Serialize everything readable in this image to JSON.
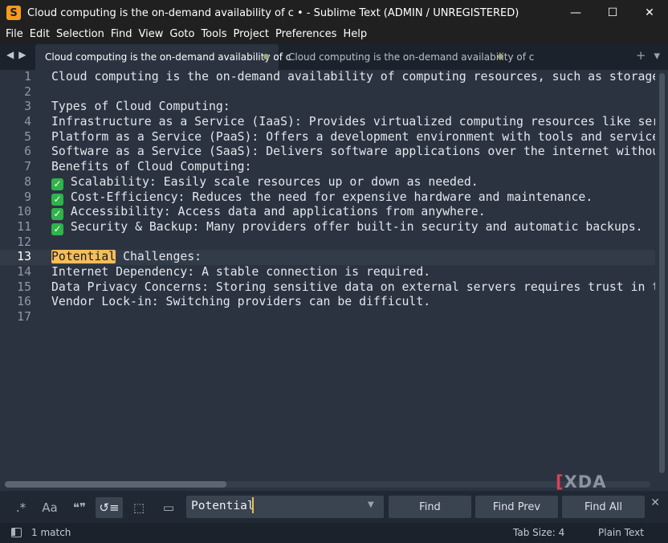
{
  "window": {
    "title": "Cloud computing is the on-demand availability of c • - Sublime Text (ADMIN / UNREGISTERED)",
    "app_icon": "S",
    "controls": {
      "minimize": "—",
      "maximize": "☐",
      "close": "✕"
    }
  },
  "menu": [
    "File",
    "Edit",
    "Selection",
    "Find",
    "View",
    "Goto",
    "Tools",
    "Project",
    "Preferences",
    "Help"
  ],
  "tabs": [
    {
      "label": "Cloud computing is the on-demand availability of c",
      "active": true,
      "modified": true
    },
    {
      "label": "Cloud computing is the on-demand availability of c",
      "active": false,
      "modified": true
    }
  ],
  "tabbar": {
    "nav_left": "◀",
    "nav_right": "▶",
    "new_tab": "+",
    "overflow": "▾"
  },
  "editor": {
    "current_line": 13,
    "lines": [
      {
        "n": "1",
        "text": "Cloud computing is the on-demand availability of computing resources, such as storage, processing power"
      },
      {
        "n": "2",
        "text": ""
      },
      {
        "n": "3",
        "text": "Types of Cloud Computing:"
      },
      {
        "n": "4",
        "text": "Infrastructure as a Service (IaaS): Provides virtualized computing resources like servers and storage."
      },
      {
        "n": "5",
        "text": "Platform as a Service (PaaS): Offers a development environment with tools and services for developers."
      },
      {
        "n": "6",
        "text": "Software as a Service (SaaS): Delivers software applications over the internet without installation."
      },
      {
        "n": "7",
        "text": "Benefits of Cloud Computing:"
      },
      {
        "n": "8",
        "check": true,
        "text": " Scalability: Easily scale resources up or down as needed."
      },
      {
        "n": "9",
        "check": true,
        "text": " Cost-Efficiency: Reduces the need for expensive hardware and maintenance."
      },
      {
        "n": "10",
        "check": true,
        "text": " Accessibility: Access data and applications from anywhere."
      },
      {
        "n": "11",
        "check": true,
        "text": " Security & Backup: Many providers offer built-in security and automatic backups."
      },
      {
        "n": "12",
        "text": ""
      },
      {
        "n": "13",
        "match": "Potential",
        "text": " Challenges:"
      },
      {
        "n": "14",
        "text": "Internet Dependency: A stable connection is required."
      },
      {
        "n": "15",
        "text": "Data Privacy Concerns: Storing sensitive data on external servers requires trust in the provider."
      },
      {
        "n": "16",
        "text": "Vendor Lock-in: Switching providers can be difficult."
      },
      {
        "n": "17",
        "text": ""
      }
    ]
  },
  "watermark": {
    "bracket_left": "[",
    "bracket_right": "]",
    "text": "XDA"
  },
  "find": {
    "options": [
      {
        "name": "regex-toggle",
        "glyph": ".*",
        "on": false
      },
      {
        "name": "case-toggle",
        "glyph": "Aa",
        "on": false
      },
      {
        "name": "whole-word-toggle",
        "glyph": "❝❞",
        "on": false
      },
      {
        "name": "wrap-toggle",
        "glyph": "↺≡",
        "on": true
      },
      {
        "name": "in-selection-toggle",
        "glyph": "⬚",
        "on": false
      },
      {
        "name": "highlight-matches-toggle",
        "glyph": "▭",
        "on": false
      }
    ],
    "query": "Potential",
    "find_label": "Find",
    "find_prev_label": "Find Prev",
    "find_all_label": "Find All",
    "close": "✕",
    "dropdown": "▼"
  },
  "status": {
    "matches": "1 match",
    "tab_size": "Tab Size: 4",
    "syntax": "Plain Text"
  },
  "colors": {
    "match_highlight": "#f5bd5c",
    "check_green": "#2fb34a",
    "app_orange": "#f79a1e"
  }
}
